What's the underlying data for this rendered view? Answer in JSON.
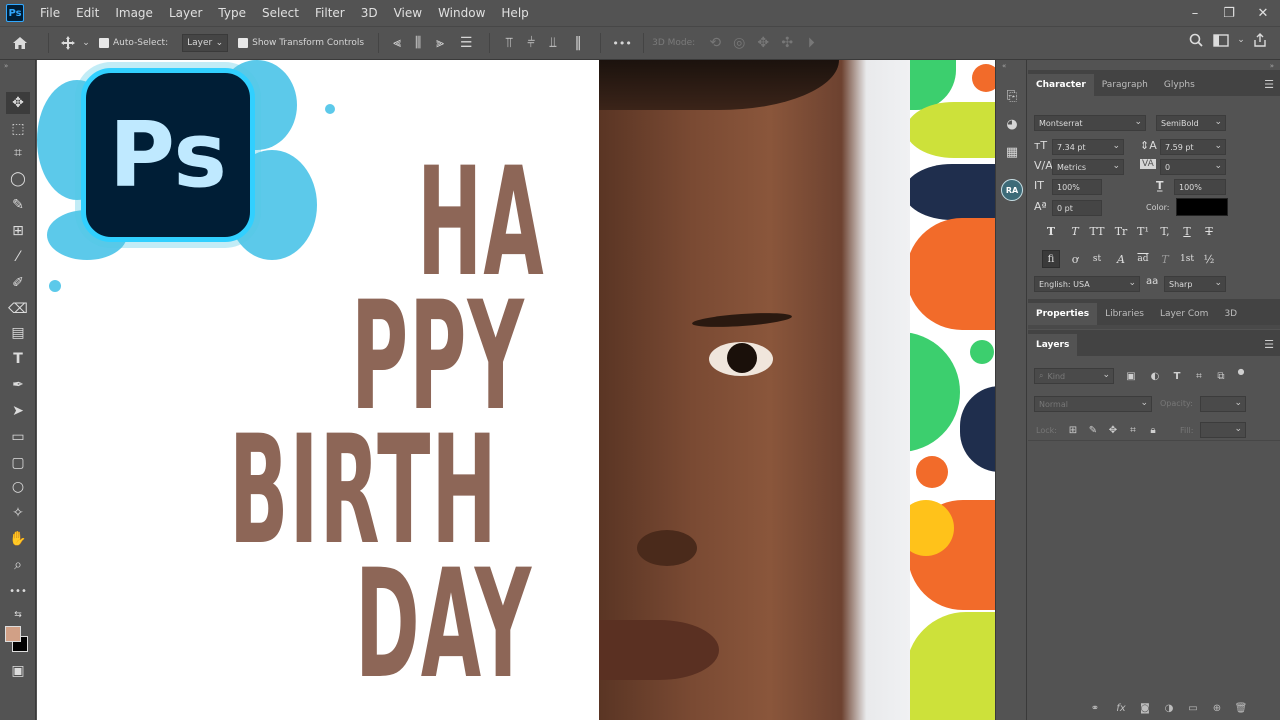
{
  "menubar": {
    "app_icon": "Ps",
    "items": [
      "File",
      "Edit",
      "Image",
      "Layer",
      "Type",
      "Select",
      "Filter",
      "3D",
      "View",
      "Window",
      "Help"
    ],
    "window_controls": [
      "–",
      "❐",
      "✕"
    ]
  },
  "options": {
    "auto_select_label": "Auto-Select:",
    "auto_select_value": "Layer",
    "show_transform_label": "Show Transform Controls",
    "more_label": "•••",
    "mode_3d_label": "3D Mode:"
  },
  "canvas": {
    "text_line1": "HA",
    "text_line2": "PPY",
    "text_line3": "BIRTH",
    "text_line4": "DAY",
    "ps_logo": "Ps",
    "pattern_colors": [
      "#f26b2a",
      "#3ccf6e",
      "#cde13a",
      "#1f2e4d",
      "#ffc21a"
    ]
  },
  "strip": {
    "badge": "RA"
  },
  "character_panel": {
    "tabs": [
      "Character",
      "Paragraph",
      "Glyphs"
    ],
    "font_family": "Montserrat",
    "font_style": "SemiBold",
    "font_size": "7.34 pt",
    "leading": "7.59 pt",
    "kerning": "Metrics",
    "tracking": "0",
    "vertical_scale": "100%",
    "horizontal_scale": "100%",
    "baseline_shift": "0 pt",
    "color_label": "Color:",
    "language": "English: USA",
    "aa_label": "aa",
    "anti_alias": "Sharp",
    "style_buttons": [
      "T",
      "T",
      "TT",
      "Tr",
      "T¹",
      "T,",
      "T",
      "T"
    ],
    "opentype_buttons": [
      "fi",
      "ơ",
      "st",
      "A",
      "ad",
      "T",
      "1st",
      "½"
    ]
  },
  "properties_panel": {
    "tabs": [
      "Properties",
      "Libraries",
      "Layer Com",
      "3D"
    ]
  },
  "layers_panel": {
    "title": "Layers",
    "kind_label": "Kind",
    "blend_mode": "Normal",
    "opacity_label": "Opacity:",
    "lock_label": "Lock:",
    "fill_label": "Fill:",
    "bottom_icons": [
      "link-icon",
      "fx-icon",
      "mask-icon",
      "adjustment-icon",
      "group-icon",
      "new-layer-icon",
      "trash-icon"
    ]
  }
}
